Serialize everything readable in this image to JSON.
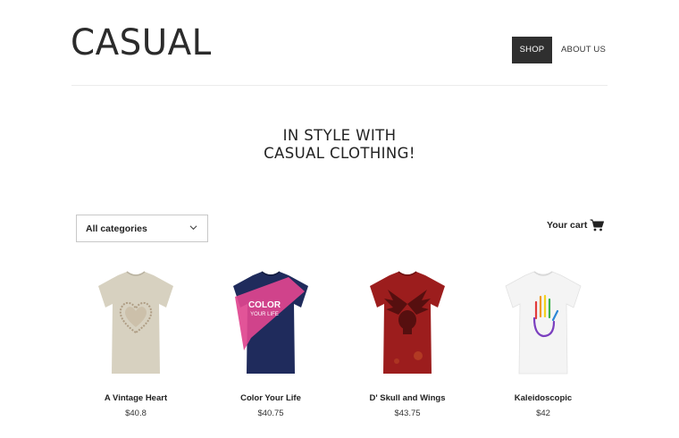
{
  "brand": {
    "logo_text": "CASUAL"
  },
  "nav": {
    "items": [
      {
        "label": "SHOP",
        "active": true
      },
      {
        "label": "ABOUT US",
        "active": false
      }
    ]
  },
  "hero": {
    "line1": "IN STYLE WITH",
    "line2": "CASUAL CLOTHING!"
  },
  "filter": {
    "selected": "All categories",
    "icon": "chevron-down-icon"
  },
  "cart": {
    "label": "Your cart",
    "icon": "cart-icon"
  },
  "products": [
    {
      "name": "A Vintage Heart",
      "price": "$40.8",
      "shirt_color": "#d7d1c0",
      "print": "heart"
    },
    {
      "name": "Color Your Life",
      "price": "$40.75",
      "shirt_color": "#1f2b5c",
      "print": "color",
      "print_text_1": "COLOR",
      "print_text_2": "YOUR LIFE"
    },
    {
      "name": "D' Skull and Wings",
      "price": "$43.75",
      "shirt_color": "#9c1d1d",
      "print": "skull"
    },
    {
      "name": "Kaleidoscopic",
      "price": "$42",
      "shirt_color": "#f4f4f4",
      "print": "hand"
    }
  ],
  "colors": {
    "nav_active_bg": "#2f2f2f",
    "text": "#222222",
    "divider": "#ececec"
  }
}
